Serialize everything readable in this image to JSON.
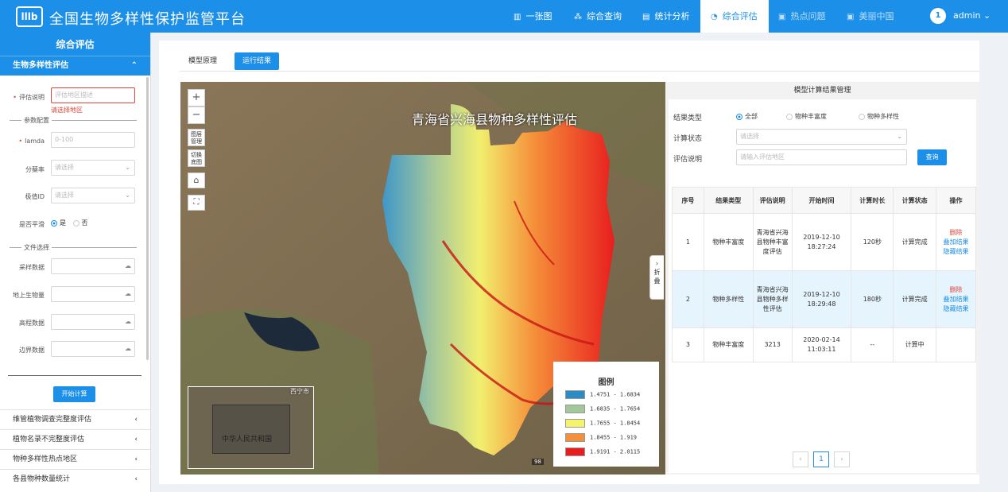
{
  "header": {
    "title": "全国生物多样性保护监管平台",
    "nav": [
      {
        "label": "一张图",
        "icon": "map-icon"
      },
      {
        "label": "综合查询",
        "icon": "cluster-icon"
      },
      {
        "label": "统计分析",
        "icon": "bar-chart-icon"
      },
      {
        "label": "综合评估",
        "icon": "dashboard-icon",
        "active": true
      },
      {
        "label": "热点问题",
        "icon": "lock-icon",
        "disabled": true
      },
      {
        "label": "美丽中国",
        "icon": "lock-icon",
        "disabled": true
      }
    ],
    "user": "admin"
  },
  "sidebar": {
    "title": "综合评估",
    "section": "生物多样性评估",
    "form": {
      "desc_label": "评估说明",
      "desc_placeholder": "评估地区描述",
      "desc_error": "请选择地区",
      "params_title": "参数配置",
      "lambda_label": "lamda",
      "lambda_placeholder": "0-100",
      "ratio_label": "分蘖率",
      "ratio_placeholder": "请选择",
      "extreme_label": "极值ID",
      "extreme_placeholder": "请选择",
      "smooth_label": "是否平滑",
      "smooth_yes": "是",
      "smooth_no": "否",
      "files_title": "文件选择",
      "file_sample": "采样数据",
      "file_biomass": "地上生物量",
      "file_elevation": "高程数据",
      "file_boundary": "边界数据",
      "start_button": "开始计算"
    },
    "items": [
      "维管植物调查完整度评估",
      "植物名录不完整度评估",
      "物种多样性热点地区",
      "各县物种数量统计"
    ]
  },
  "tabs": [
    "模型原理",
    "运行结果"
  ],
  "map": {
    "title": "青海省兴海县物种多样性评估",
    "buttons": {
      "zoom_in": "+",
      "zoom_out": "−",
      "layers": "图层管理",
      "switch": "切换底图"
    },
    "inset_label": "中华人民共和国",
    "inset_city": "西宁市",
    "scale": "98",
    "legend_title": "图例",
    "legend": [
      {
        "range": "1.4751 - 1.6834",
        "color": "#2b8cc4"
      },
      {
        "range": "1.6835 - 1.7654",
        "color": "#a2c79a"
      },
      {
        "range": "1.7655 - 1.8454",
        "color": "#f4f36a"
      },
      {
        "range": "1.8455 - 1.919",
        "color": "#f5903a"
      },
      {
        "range": "1.9191 - 2.0115",
        "color": "#e81e1e"
      }
    ],
    "fold": "折叠"
  },
  "results": {
    "title": "模型计算结果管理",
    "type_label": "结果类型",
    "type_options": [
      "全部",
      "物种丰富度",
      "物种多样性"
    ],
    "status_label": "计算状态",
    "status_placeholder": "请选择",
    "desc_label": "评估说明",
    "desc_placeholder": "请输入评估地区",
    "query_button": "查询",
    "columns": [
      "序号",
      "结果类型",
      "评估说明",
      "开始时间",
      "计算时长",
      "计算状态",
      "操作"
    ],
    "rows": [
      {
        "no": "1",
        "type": "物种丰富度",
        "desc": "青海省兴海县物种丰富度评估",
        "start": "2019-12-10 18:27:24",
        "duration": "120秒",
        "status": "计算完成",
        "ops": [
          "删除",
          "叠加结果",
          "隐藏结果"
        ]
      },
      {
        "no": "2",
        "type": "物种多样性",
        "desc": "青海省兴海县物种多样性评估",
        "start": "2019-12-10 18:29:48",
        "duration": "180秒",
        "status": "计算完成",
        "ops": [
          "删除",
          "叠加结果",
          "隐藏结果"
        ]
      },
      {
        "no": "3",
        "type": "物种丰富度",
        "desc": "3213",
        "start": "2020-02-14 11:03:11",
        "duration": "--",
        "status": "计算中",
        "ops": []
      }
    ],
    "page": "1"
  }
}
